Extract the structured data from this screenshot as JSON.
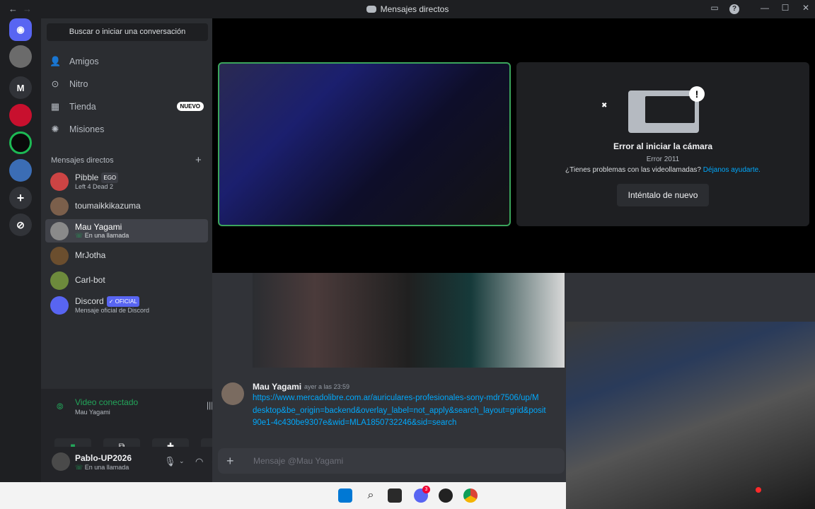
{
  "window": {
    "title": "Mensajes directos"
  },
  "sidebar": {
    "search_label": "Buscar o iniciar una conversación",
    "nav": [
      {
        "label": "Amigos",
        "icon": "friends-icon"
      },
      {
        "label": "Nitro",
        "icon": "nitro-icon"
      },
      {
        "label": "Tienda",
        "icon": "shop-icon",
        "badge": "NUEVO"
      },
      {
        "label": "Misiones",
        "icon": "quests-icon"
      }
    ],
    "dm_header": "Mensajes directos",
    "dms": [
      {
        "name": "Pibble",
        "tag": "EGO",
        "sub": "Left 4 Dead 2"
      },
      {
        "name": "toumaikkikazuma",
        "sub": ""
      },
      {
        "name": "Mau Yagami",
        "sub": "En una llamada",
        "selected": true
      },
      {
        "name": "MrJotha",
        "sub": ""
      },
      {
        "name": "Carl-bot",
        "sub": ""
      },
      {
        "name": "Discord",
        "tag": "OFICIAL",
        "sub": "Mensaje oficial de Discord"
      }
    ]
  },
  "voice": {
    "status": "Video conectado",
    "channel": "Mau Yagami"
  },
  "user": {
    "name": "Pablo-UP2026",
    "status": "En una llamada"
  },
  "call": {
    "error_title": "Error al iniciar la cámara",
    "error_code": "Error 2011",
    "help_text": "¿Tienes problemas con las videollamadas?",
    "help_link": "Déjanos ayudarte.",
    "retry_label": "Inténtalo de nuevo"
  },
  "message": {
    "author": "Mau Yagami",
    "time": "ayer a las 23:59",
    "lines": [
      "https://www.mercadolibre.com.ar/auriculares-profesionales-sony-mdr7506/up/M",
      "desktop&be_origin=backend&overlay_label=not_apply&search_layout=grid&posit",
      "90e1-4c430be9307e&wid=MLA1850732246&sid=search"
    ]
  },
  "composer": {
    "placeholder": "Mensaje @Mau Yagami"
  },
  "taskbar": {
    "discord_badge": "3"
  },
  "colors": {
    "online": "#23a55a",
    "link": "#00a8fc",
    "blurple": "#5865f2",
    "green_border": "#3ba55c"
  }
}
